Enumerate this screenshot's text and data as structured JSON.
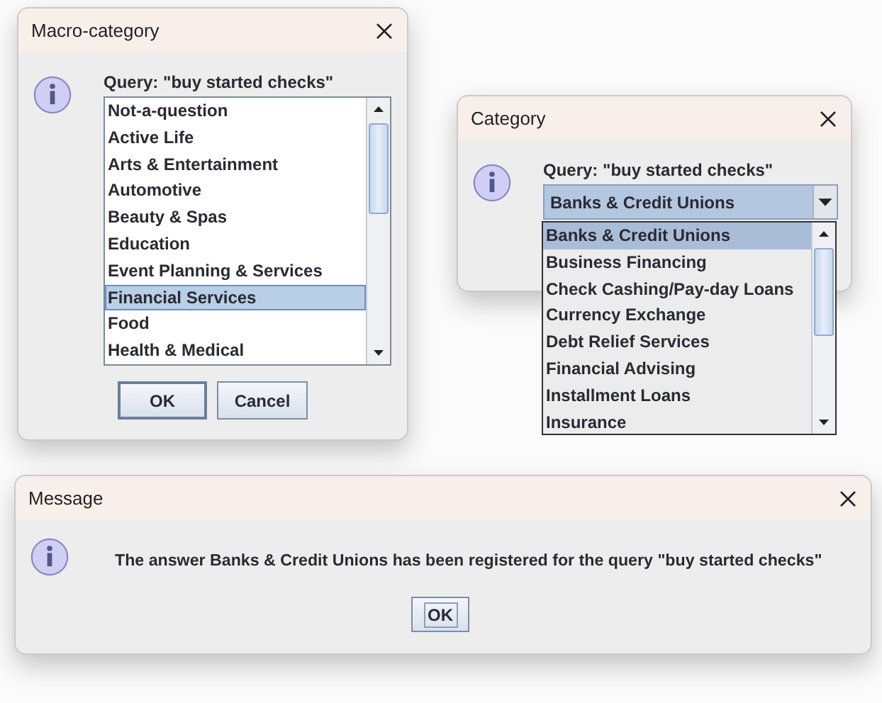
{
  "macro_dialog": {
    "title": "Macro-category",
    "query": "Query: \"buy started checks\"",
    "items": [
      {
        "label": "Not-a-question",
        "selected": false
      },
      {
        "label": "Active Life",
        "selected": false
      },
      {
        "label": "Arts & Entertainment",
        "selected": false
      },
      {
        "label": "Automotive",
        "selected": false
      },
      {
        "label": "Beauty & Spas",
        "selected": false
      },
      {
        "label": "Education",
        "selected": false
      },
      {
        "label": "Event Planning & Services",
        "selected": false
      },
      {
        "label": "Financial Services",
        "selected": true
      },
      {
        "label": "Food",
        "selected": false
      },
      {
        "label": "Health & Medical",
        "selected": false
      }
    ],
    "buttons": [
      "OK",
      "Cancel"
    ]
  },
  "category_dialog": {
    "title": "Category",
    "query": "Query: \"buy started checks\"",
    "combo_value": "Banks & Credit Unions",
    "options": [
      {
        "label": "Banks & Credit Unions",
        "selected": true
      },
      {
        "label": "Business Financing",
        "selected": false
      },
      {
        "label": "Check Cashing/Pay-day Loans",
        "selected": false
      },
      {
        "label": "Currency Exchange",
        "selected": false
      },
      {
        "label": "Debt Relief Services",
        "selected": false
      },
      {
        "label": "Financial Advising",
        "selected": false
      },
      {
        "label": "Installment Loans",
        "selected": false
      },
      {
        "label": "Insurance",
        "selected": false
      }
    ]
  },
  "message_dialog": {
    "title": "Message",
    "text": "The answer Banks & Credit Unions has been registered for the query \"buy started checks\"",
    "buttons": [
      "OK"
    ]
  }
}
